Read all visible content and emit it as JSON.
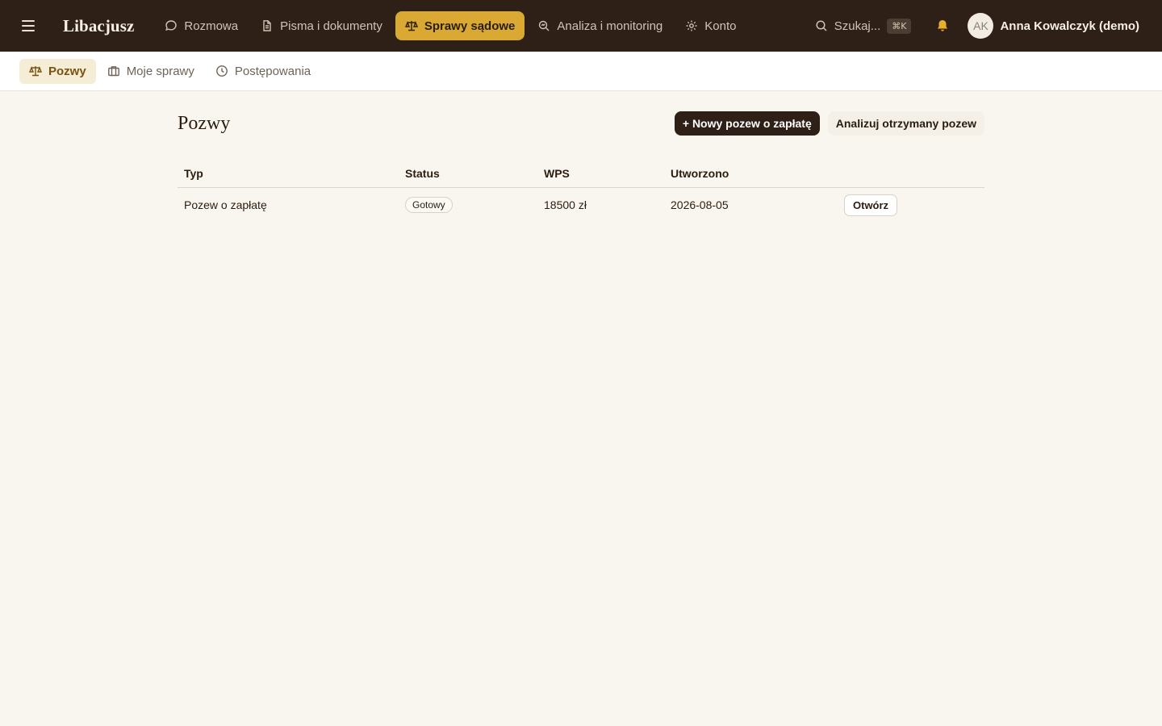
{
  "app": {
    "brand": "Libacjusz",
    "colors": {
      "topbar": "#2e2016",
      "accent": "#d9a933",
      "background": "#f9f6ef"
    }
  },
  "topnav": {
    "menu_icon": "hamburger-menu-icon",
    "items": [
      {
        "label": "Rozmowa",
        "icon": "chat-bubble-icon",
        "active": false
      },
      {
        "label": "Pisma i dokumenty",
        "icon": "document-icon",
        "active": false
      },
      {
        "label": "Sprawy sądowe",
        "icon": "scales-icon",
        "active": true
      },
      {
        "label": "Analiza i monitoring",
        "icon": "search-analysis-icon",
        "active": false
      },
      {
        "label": "Konto",
        "icon": "gear-icon",
        "active": false
      }
    ]
  },
  "topright": {
    "search_label": "Szukaj...",
    "search_shortcut": "⌘K",
    "bell_icon": "bell-icon",
    "avatar_initials": "AK",
    "user_name": "Anna Kowalczyk (demo)"
  },
  "subnav": {
    "items": [
      {
        "label": "Pozwy",
        "icon": "scales-icon",
        "active": true
      },
      {
        "label": "Moje sprawy",
        "icon": "briefcase-icon",
        "active": false
      },
      {
        "label": "Postępowania",
        "icon": "clock-icon",
        "active": false
      }
    ]
  },
  "main": {
    "title": "Pozwy",
    "new_button": "+ Nowy pozew o zapłatę",
    "analyze_button": "Analizuj otrzymany pozew",
    "table": {
      "columns": [
        "Typ",
        "Status",
        "WPS",
        "Utworzono",
        ""
      ],
      "rows": [
        {
          "type": "Pozew o zapłatę",
          "status": "Gotowy",
          "wps": "18500 zł",
          "created": "2026-08-05",
          "action": "Otwórz"
        }
      ]
    }
  }
}
